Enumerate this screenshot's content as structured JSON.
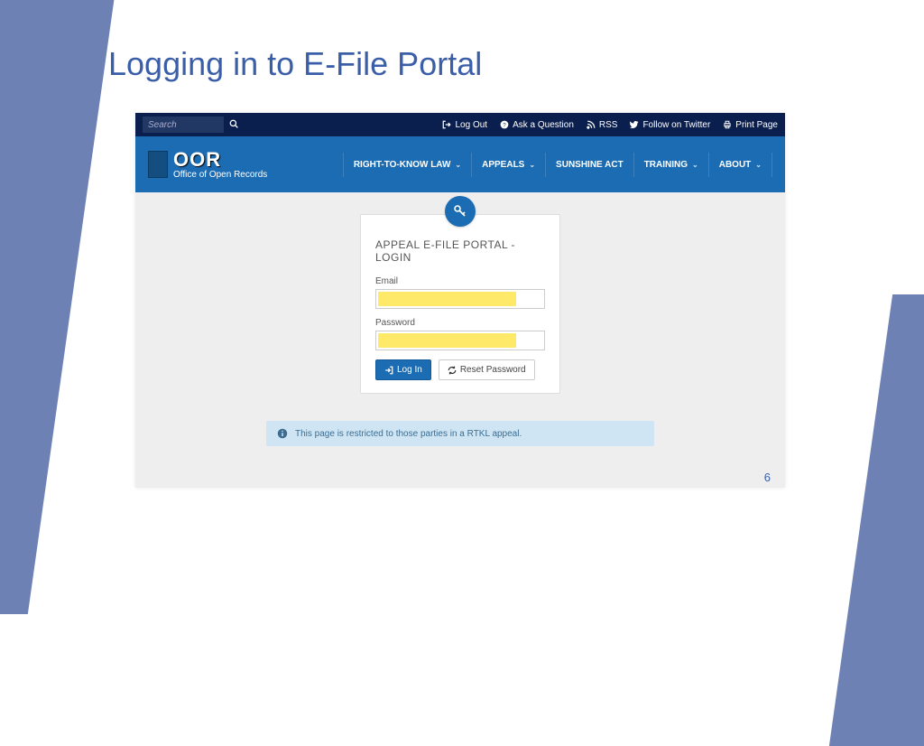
{
  "slide": {
    "title": "Logging in to E-File Portal",
    "page_number": "6"
  },
  "topbar": {
    "search_placeholder": "Search",
    "links": {
      "logout": "Log Out",
      "ask": "Ask a Question",
      "rss": "RSS",
      "twitter": "Follow on Twitter",
      "print": "Print Page"
    }
  },
  "header": {
    "logo_main": "OOR",
    "logo_sub": "Office of Open Records",
    "nav": {
      "rtk": "RIGHT-TO-KNOW LAW",
      "appeals": "APPEALS",
      "sunshine": "SUNSHINE ACT",
      "training": "TRAINING",
      "about": "ABOUT"
    }
  },
  "login": {
    "title": "APPEAL E-FILE PORTAL - LOGIN",
    "email_label": "Email",
    "password_label": "Password",
    "login_button": "Log In",
    "reset_button": "Reset Password"
  },
  "info": {
    "message": "This page is restricted to those parties in a RTKL appeal."
  }
}
